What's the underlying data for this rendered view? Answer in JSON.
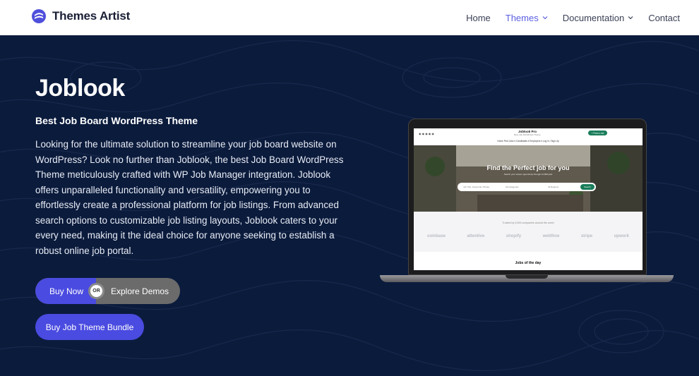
{
  "header": {
    "brand": "Themes Artist",
    "nav": [
      {
        "label": "Home"
      },
      {
        "label": "Themes"
      },
      {
        "label": "Documentation"
      },
      {
        "label": "Contact"
      }
    ]
  },
  "hero": {
    "title": "Joblook",
    "subtitle": "Best Job Board WordPress Theme",
    "description": "Looking for the ultimate solution to streamline your job board website on WordPress? Look no further than Joblook, the best Job Board WordPress Theme meticulously crafted with WP Job Manager integration. Joblook offers unparalleled functionality and versatility, empowering you to effortlessly create a professional platform for job listings. From advanced search options to customizable job listing layouts, Joblook caters to your every need, making it the ideal choice for anyone seeking to establish a robust online job portal.",
    "buttons": {
      "buy_now": "Buy Now",
      "or": "OR",
      "explore": "Explore Demos",
      "bundle": "Buy Job Theme Bundle"
    }
  },
  "preview": {
    "brand": "Joblook Pro",
    "brand_sub": "Best Job WordPress Theme",
    "post_job": "+ Post a Job",
    "nav": "Home   Find Jobs ▾   Candidates ▾   Employers ▾   Log In / Sign Up",
    "hero_title": "Find the Perfect job for you",
    "hero_sub": "Search your career opportunity through 12,800 jobs",
    "search_keyword": "Job Title, Keywords, Phrase",
    "search_category": "All Categories",
    "search_location": "All Regions",
    "search_button": "Search",
    "trusted": "Trusted by 5,000 companies around the world",
    "logos": [
      "coinbase",
      "attentive",
      "shopify",
      "webflow",
      "stripe",
      "upwork"
    ],
    "jobs_title": "Jobs of the day"
  },
  "colors": {
    "accent": "#5b5fe0",
    "button": "#4a4be0",
    "hero_bg": "#0b1b3c",
    "explore_bg": "#6b6b6b",
    "preview_green": "#1a7d5a"
  }
}
